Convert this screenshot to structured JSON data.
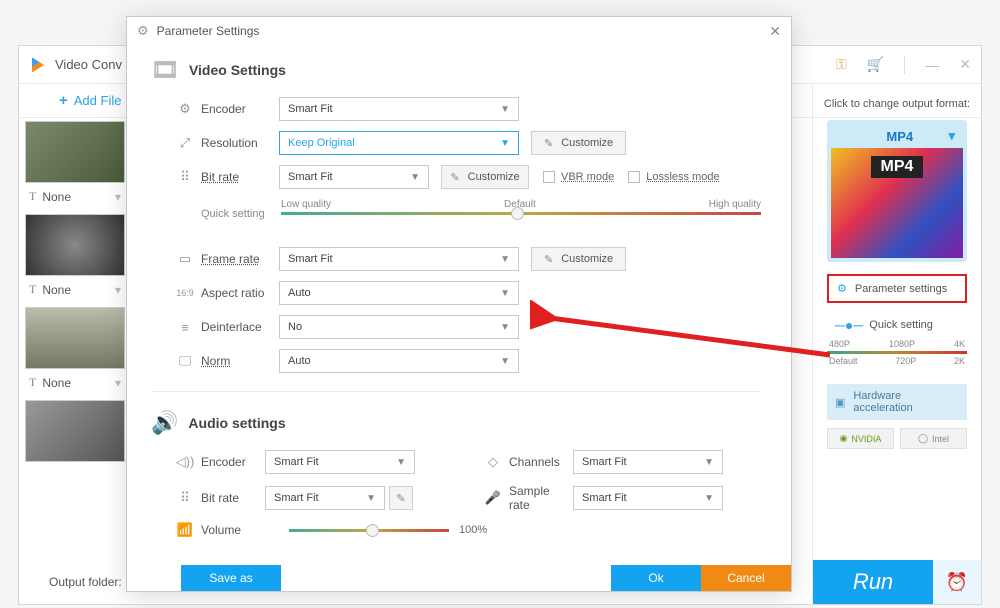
{
  "main": {
    "title": "Video Conv",
    "add_file": "Add File",
    "output_folder": "Output folder:",
    "run": "Run"
  },
  "thumbs": {
    "none": "None"
  },
  "output": {
    "click_change": "Click to change output format:",
    "format": "MP4",
    "format_img": "MP4",
    "param_btn": "Parameter settings",
    "quick_setting": "Quick setting",
    "res_top": [
      "480P",
      "1080P",
      "4K"
    ],
    "res_bottom": [
      "Default",
      "720P",
      "2K"
    ],
    "hw_accel": "Hardware acceleration",
    "nvidia": "NVIDIA",
    "intel": "Intel"
  },
  "modal": {
    "title": "Parameter Settings",
    "video_section": "Video Settings",
    "audio_section": "Audio settings",
    "fields": {
      "encoder": "Encoder",
      "resolution": "Resolution",
      "bitrate": "Bit rate",
      "quick_setting": "Quick setting",
      "framerate": "Frame rate",
      "aspect": "Aspect ratio",
      "deinterlace": "Deinterlace",
      "norm": "Norm",
      "channels": "Channels",
      "samplerate": "Sample rate",
      "volume": "Volume"
    },
    "values": {
      "encoder": "Smart Fit",
      "resolution": "Keep Original",
      "bitrate": "Smart Fit",
      "framerate": "Smart Fit",
      "aspect": "Auto",
      "deinterlace": "No",
      "norm": "Auto",
      "a_encoder": "Smart Fit",
      "a_bitrate": "Smart Fit",
      "channels": "Smart Fit",
      "samplerate": "Smart Fit",
      "volume": "100%"
    },
    "quality": {
      "low": "Low quality",
      "default": "Default",
      "high": "High quality"
    },
    "customize": "Customize",
    "vbr": "VBR mode",
    "lossless": "Lossless mode",
    "save_as": "Save as",
    "ok": "Ok",
    "cancel": "Cancel"
  }
}
